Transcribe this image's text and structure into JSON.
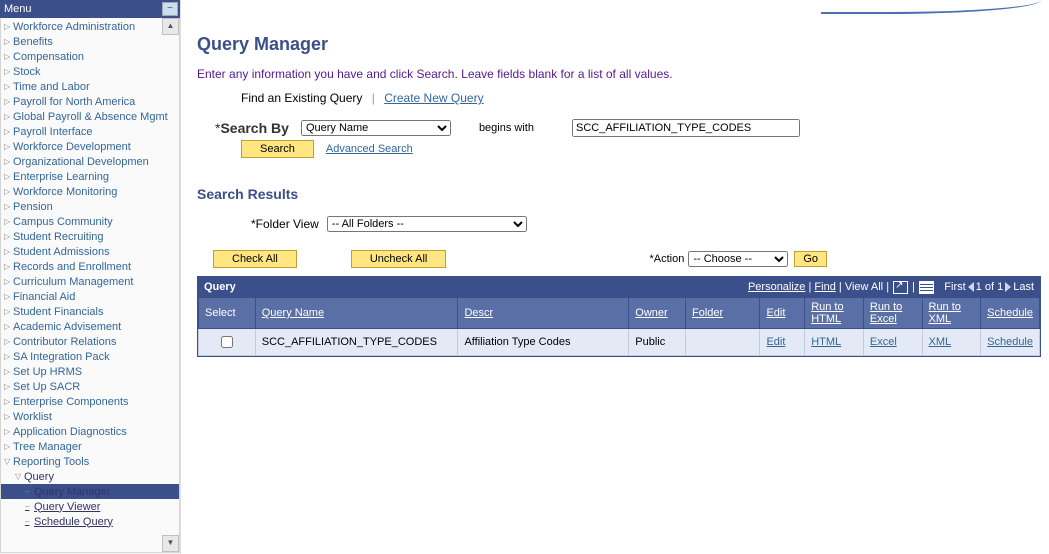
{
  "menu": {
    "title": "Menu",
    "items": [
      "Workforce Administration",
      "Benefits",
      "Compensation",
      "Stock",
      "Time and Labor",
      "Payroll for North America",
      "Global Payroll & Absence Mgmt",
      "Payroll Interface",
      "Workforce Development",
      "Organizational Developmen",
      "Enterprise Learning",
      "Workforce Monitoring",
      "Pension",
      "Campus Community",
      "Student Recruiting",
      "Student Admissions",
      "Records and Enrollment",
      "Curriculum Management",
      "Financial Aid",
      "Student Financials",
      "Academic Advisement",
      "Contributor Relations",
      "SA Integration Pack",
      "Set Up HRMS",
      "Set Up SACR",
      "Enterprise Components",
      "Worklist",
      "Application Diagnostics",
      "Tree Manager",
      "Reporting Tools"
    ],
    "reporting_tools": {
      "query": {
        "label": "Query",
        "items": [
          "Query Manager",
          "Query Viewer",
          "Schedule Query"
        ],
        "active": "Query Manager"
      }
    }
  },
  "page": {
    "title": "Query Manager",
    "instruction": "Enter any information you have and click Search. Leave fields blank for a list of all values.",
    "subnav": {
      "existing": "Find an Existing Query",
      "create": "Create New Query"
    },
    "search": {
      "by_label": "Search By",
      "by_value": "Query Name",
      "begins_with": "begins with",
      "value": "SCC_AFFILIATION_TYPE_CODES",
      "button": "Search",
      "advanced": "Advanced Search"
    },
    "results": {
      "heading": "Search Results",
      "folder_label": "*Folder View",
      "folder_value": "-- All Folders --",
      "check_all": "Check All",
      "uncheck_all": "Uncheck All",
      "action_label": "*Action",
      "action_value": "-- Choose --",
      "go": "Go"
    },
    "grid": {
      "title": "Query",
      "toolbar": {
        "personalize": "Personalize",
        "find": "Find",
        "view_all": "View All",
        "first": "First",
        "range": "1 of 1",
        "last": "Last"
      },
      "columns": {
        "select": "Select",
        "query_name": "Query Name",
        "descr": "Descr",
        "owner": "Owner",
        "folder": "Folder",
        "edit": "Edit",
        "run_html": "Run to HTML",
        "run_excel": "Run to Excel",
        "run_xml": "Run to XML",
        "schedule": "Schedule"
      },
      "rows": [
        {
          "query_name": "SCC_AFFILIATION_TYPE_CODES",
          "descr": "Affiliation Type Codes",
          "owner": "Public",
          "folder": "",
          "edit": "Edit",
          "html": "HTML",
          "excel": "Excel",
          "xml": "XML",
          "schedule": "Schedule"
        }
      ]
    }
  }
}
